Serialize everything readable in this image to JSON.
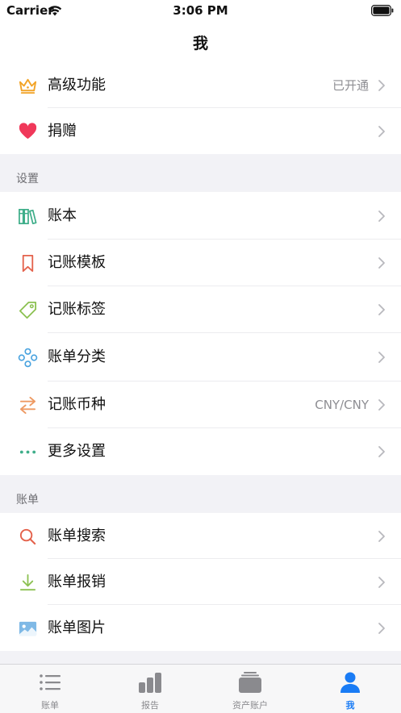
{
  "status": {
    "carrier": "Carrier",
    "time": "3:06 PM"
  },
  "nav": {
    "title": "我"
  },
  "colors": {
    "accent": "#1a7cf5",
    "crown": "#f2a428",
    "heart": "#f0385a"
  },
  "top_rows": [
    {
      "label": "高级功能",
      "value": "已开通",
      "icon": "crown-icon"
    },
    {
      "label": "捐赠",
      "value": "",
      "icon": "heart-icon"
    }
  ],
  "sections": {
    "settings": {
      "title": "设置",
      "items": [
        {
          "label": "账本",
          "value": "",
          "icon": "books-icon"
        },
        {
          "label": "记账模板",
          "value": "",
          "icon": "bookmark-icon"
        },
        {
          "label": "记账标签",
          "value": "",
          "icon": "tag-icon"
        },
        {
          "label": "账单分类",
          "value": "",
          "icon": "category-icon"
        },
        {
          "label": "记账币种",
          "value": "CNY/CNY",
          "icon": "exchange-icon"
        },
        {
          "label": "更多设置",
          "value": "",
          "icon": "more-dots-icon"
        }
      ]
    },
    "bills": {
      "title": "账单",
      "items": [
        {
          "label": "账单搜索",
          "value": "",
          "icon": "search-icon"
        },
        {
          "label": "账单报销",
          "value": "",
          "icon": "download-icon"
        },
        {
          "label": "账单图片",
          "value": "",
          "icon": "image-icon"
        }
      ]
    }
  },
  "tabs": [
    {
      "label": "账单",
      "icon": "list-icon",
      "active": false
    },
    {
      "label": "报告",
      "icon": "bar-chart-icon",
      "active": false
    },
    {
      "label": "资产账户",
      "icon": "wallet-icon",
      "active": false
    },
    {
      "label": "我",
      "icon": "person-icon",
      "active": true
    }
  ]
}
